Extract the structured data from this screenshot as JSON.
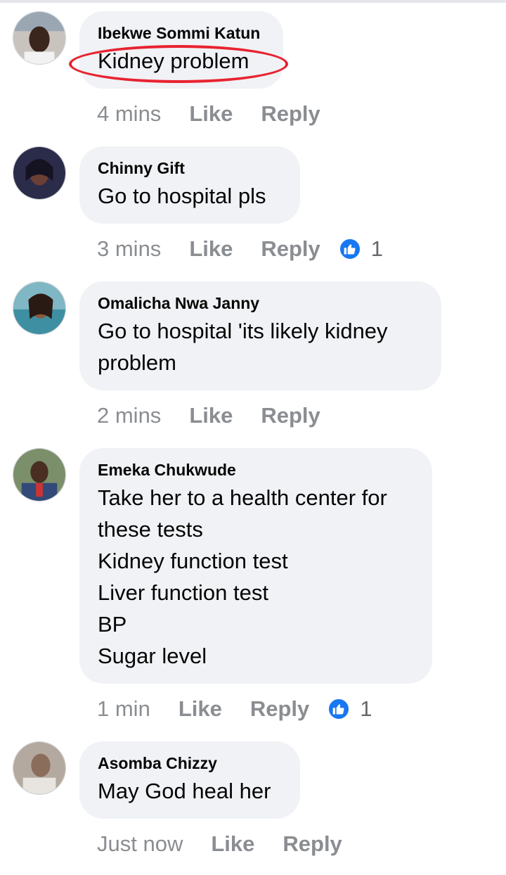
{
  "accent": "#1877f2",
  "highlight_color": "#e82330",
  "comments": [
    {
      "author": "Ibekwe Sommi Katun",
      "text": "Kidney problem",
      "time": "4 mins",
      "like": "Like",
      "reply": "Reply",
      "reactions": ""
    },
    {
      "author": "Chinny Gift",
      "text": "Go to hospital pls",
      "time": "3 mins",
      "like": "Like",
      "reply": "Reply",
      "reactions": "1",
      "reaction_icon": "thumbs-up-icon"
    },
    {
      "author": "Omalicha Nwa Janny",
      "text": "Go  to hospital 'its  likely kidney\nproblem",
      "time": "2 mins",
      "like": "Like",
      "reply": "Reply",
      "reactions": ""
    },
    {
      "author": "Emeka Chukwude",
      "text": "Take her to a health center for\nthese tests\nKidney function test\nLiver function test\nBP\nSugar level",
      "time": "1 min",
      "like": "Like",
      "reply": "Reply",
      "reactions": "1",
      "reaction_icon": "thumbs-up-icon"
    },
    {
      "author": "Asomba Chizzy",
      "text": "May God heal her",
      "time": "Just now",
      "like": "Like",
      "reply": "Reply",
      "reactions": ""
    }
  ]
}
